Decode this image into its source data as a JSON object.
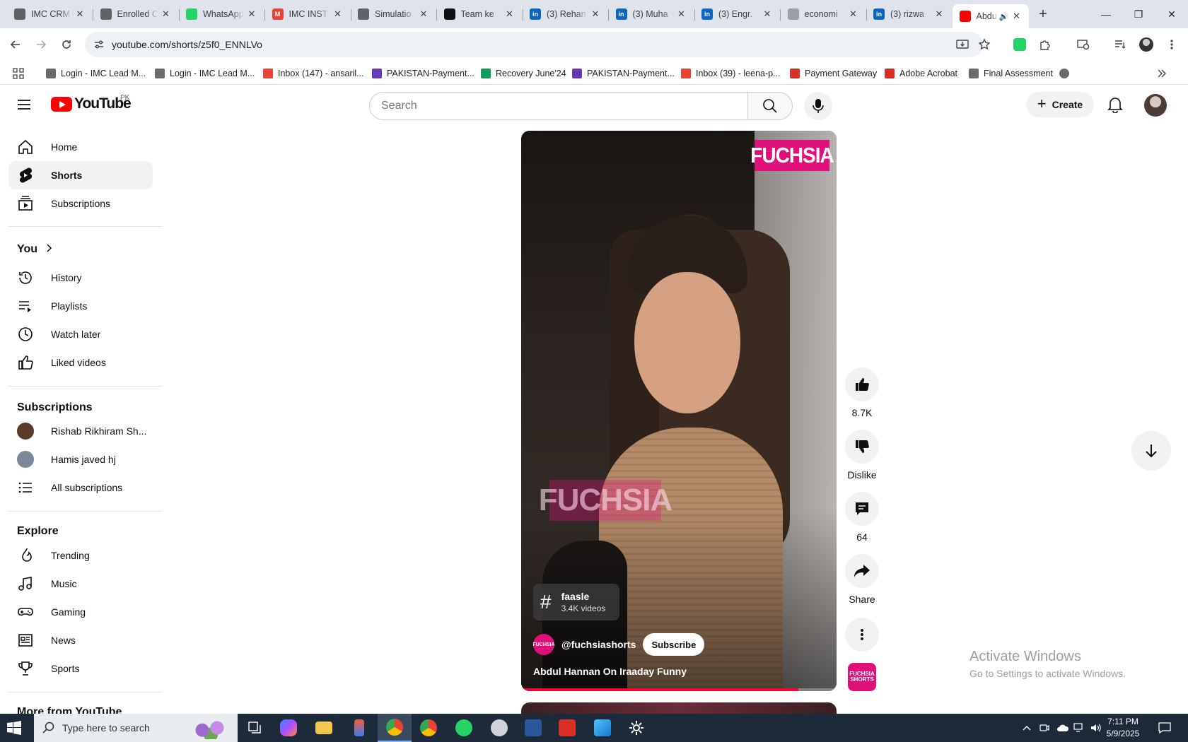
{
  "browser": {
    "tabs": [
      {
        "title": "IMC CRM",
        "icon": "imc-icon",
        "color": "#5f6368"
      },
      {
        "title": "Enrolled C",
        "icon": "imc-icon",
        "color": "#5f6368"
      },
      {
        "title": "WhatsApp",
        "icon": "whatsapp-icon",
        "color": "#25d366"
      },
      {
        "title": "IMC INST",
        "icon": "gmail-icon",
        "color": "#ea4335"
      },
      {
        "title": "Simulatio",
        "icon": "imc-icon",
        "color": "#5f6368"
      },
      {
        "title": "Team ke",
        "icon": "openai-icon",
        "color": "#111111"
      },
      {
        "title": "(3) Rehan",
        "icon": "linkedin-icon",
        "color": "#0a66c2"
      },
      {
        "title": "(3) Muha",
        "icon": "linkedin-icon",
        "color": "#0a66c2"
      },
      {
        "title": "(3) Engr.",
        "icon": "linkedin-icon",
        "color": "#0a66c2"
      },
      {
        "title": "economi",
        "icon": "globe-icon",
        "color": "#9aa0a6"
      },
      {
        "title": "(3) rizwa",
        "icon": "linkedin-icon",
        "color": "#0a66c2"
      },
      {
        "title": "Abdu",
        "icon": "youtube-icon",
        "color": "#ff0000",
        "active": true
      }
    ],
    "url": "youtube.com/shorts/z5f0_ENNLVo",
    "bookmarks": [
      {
        "label": "Login - IMC Lead M...",
        "color": "#6b6b6b"
      },
      {
        "label": "Login - IMC Lead M...",
        "color": "#6b6b6b"
      },
      {
        "label": "Inbox (147) - ansaril...",
        "color": "#ea4335"
      },
      {
        "label": "PAKISTAN-Payment...",
        "color": "#673ab7"
      },
      {
        "label": "Recovery June'24",
        "color": "#0f9d58"
      },
      {
        "label": "PAKISTAN-Payment...",
        "color": "#673ab7"
      },
      {
        "label": "Inbox (39) - leena-p...",
        "color": "#ea4335"
      },
      {
        "label": "Payment Gateway",
        "color": "#d93025"
      },
      {
        "label": "Adobe Acrobat",
        "color": "#d93025"
      },
      {
        "label": "Final Assessment",
        "color": "#6b6b6b"
      }
    ]
  },
  "youtube": {
    "logo_text": "YouTube",
    "country_code": "PK",
    "search_placeholder": "Search",
    "create_label": "Create",
    "sidebar": {
      "main": [
        {
          "label": "Home",
          "icon": "home-icon"
        },
        {
          "label": "Shorts",
          "icon": "shorts-icon",
          "active": true
        },
        {
          "label": "Subscriptions",
          "icon": "subscriptions-icon"
        }
      ],
      "you_title": "You",
      "you": [
        {
          "label": "History",
          "icon": "history-icon"
        },
        {
          "label": "Playlists",
          "icon": "playlists-icon"
        },
        {
          "label": "Watch later",
          "icon": "clock-icon"
        },
        {
          "label": "Liked videos",
          "icon": "thumbs-up-icon"
        }
      ],
      "subscriptions_title": "Subscriptions",
      "subscriptions": [
        {
          "label": "Rishab Rikhiram Sh...",
          "avatar_color": "#5a3a2a"
        },
        {
          "label": "Hamis javed hj",
          "avatar_color": "#7a8a9a"
        },
        {
          "label": "All subscriptions",
          "icon": "list-icon"
        }
      ],
      "explore_title": "Explore",
      "explore": [
        {
          "label": "Trending",
          "icon": "trending-icon"
        },
        {
          "label": "Music",
          "icon": "music-icon"
        },
        {
          "label": "Gaming",
          "icon": "gaming-icon"
        },
        {
          "label": "News",
          "icon": "news-icon"
        },
        {
          "label": "Sports",
          "icon": "trophy-icon"
        }
      ],
      "more_title": "More from YouTube"
    },
    "short": {
      "brand": "FUCHSIA",
      "watermark": "FUCHSIA",
      "hashtag": "faasle",
      "hashtag_count": "3.4K videos",
      "channel": "@fuchsiashorts",
      "channel_avatar_text": "FUCHSIA",
      "subscribe_label": "Subscribe",
      "title": "Abdul Hannan On Iraaday Funny",
      "progress": 0.88
    },
    "actions": {
      "likes": "8.7K",
      "dislike_label": "Dislike",
      "comments": "64",
      "share_label": "Share",
      "channel_thumb_text": "FUCHSIA SHORTS"
    }
  },
  "windows": {
    "activate_title": "Activate Windows",
    "activate_sub": "Go to Settings to activate Windows.",
    "search_placeholder": "Type here to search",
    "time": "7:11 PM",
    "date": "5/9/2025"
  }
}
